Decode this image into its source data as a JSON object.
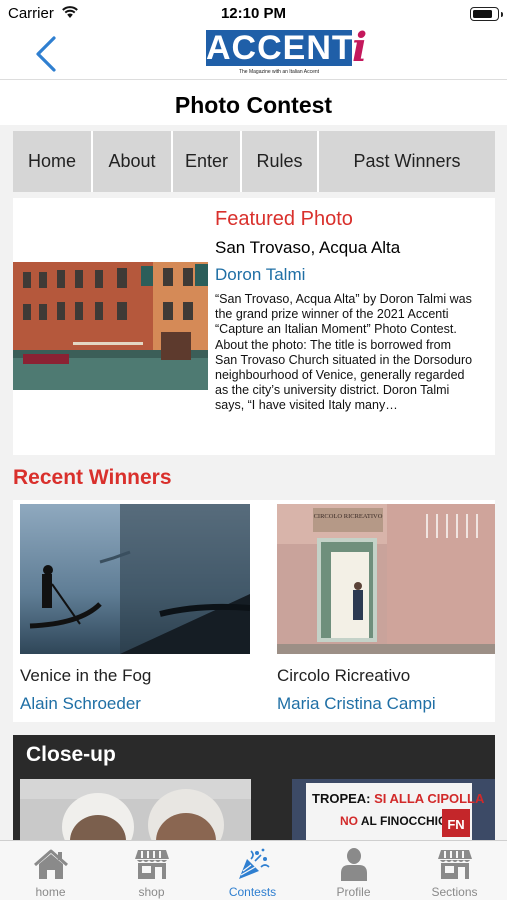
{
  "status": {
    "carrier": "Carrier",
    "time": "12:10 PM",
    "battery_level": 0.85
  },
  "nav": {
    "logo_text": "ACCENT",
    "logo_i": "i",
    "logo_tagline": "The Magazine with an Italian Accent"
  },
  "page": {
    "title": "Photo Contest"
  },
  "tabs": [
    {
      "label": "Home"
    },
    {
      "label": "About"
    },
    {
      "label": "Enter"
    },
    {
      "label": "Rules"
    },
    {
      "label": "Past Winners"
    }
  ],
  "featured": {
    "kicker": "Featured Photo",
    "title": "San Trovaso, Acqua Alta",
    "author": "Doron Talmi",
    "excerpt": "“San Trovaso, Acqua Alta” by Doron Talmi was the grand prize winner of the 2021 Accenti “Capture an Italian Moment” Photo Contest. About the photo: The title is borrowed from San Trovaso Church situated in the Dorsoduro neighbourhood of Venice, generally regarded as the city’s university district. Doron Talmi says, “I have visited Italy many…"
  },
  "recent": {
    "heading": "Recent Winners",
    "items": [
      {
        "title": "Venice in the Fog",
        "author": "Alain Schroeder"
      },
      {
        "title": "Circolo Ricreativo",
        "author": "Maria Cristina Campi",
        "sign": "CIRCOLO RICREATIVO"
      }
    ]
  },
  "closeup": {
    "heading": "Close-up",
    "banner_line1_a": "TROPEA: ",
    "banner_line1_b": "SI ALLA CIPOLLA",
    "banner_line2_a": "NO ",
    "banner_line2_b": "AL FINOCCHIO !",
    "banner_badge": "FN"
  },
  "tabbar": [
    {
      "label": "home",
      "icon": "home-icon",
      "active": false
    },
    {
      "label": "shop",
      "icon": "shop-icon",
      "active": false
    },
    {
      "label": "Contests",
      "icon": "contests-icon",
      "active": true
    },
    {
      "label": "Profile",
      "icon": "profile-icon",
      "active": false
    },
    {
      "label": "Sections",
      "icon": "sections-icon",
      "active": false
    }
  ],
  "colors": {
    "accent_red": "#d9302c",
    "link_blue": "#1f6fa5",
    "active_blue": "#2f7fd0",
    "logo_blue": "#1f5fa8",
    "logo_magenta": "#c4185c"
  }
}
